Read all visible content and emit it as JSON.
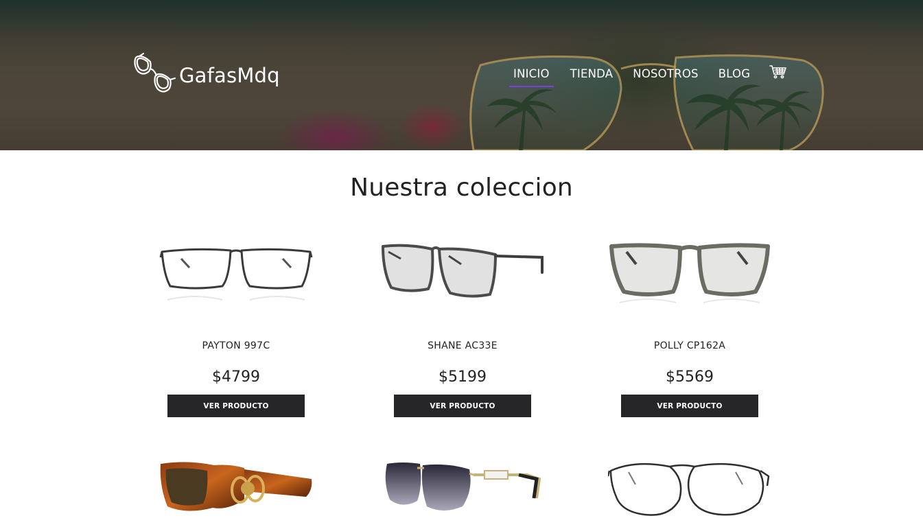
{
  "brand": {
    "name": "GafasMdq",
    "icon": "glasses-logo-icon"
  },
  "nav": {
    "items": [
      {
        "label": "INICIO",
        "active": true
      },
      {
        "label": "TIENDA",
        "active": false
      },
      {
        "label": "NOSOTROS",
        "active": false
      },
      {
        "label": "BLOG",
        "active": false
      }
    ],
    "cart_icon": "cart-icon"
  },
  "colors": {
    "accent": "#7b3fe0",
    "button_bg": "#262628",
    "button_text": "#ffffff",
    "text": "#222222"
  },
  "collection": {
    "title": "Nuestra coleccion",
    "button_label": "VER PRODUCTO",
    "products": [
      {
        "name": "PAYTON 997C",
        "price": "$4799"
      },
      {
        "name": "SHANE AC33E",
        "price": "$5199"
      },
      {
        "name": "POLLY CP162A",
        "price": "$5569"
      }
    ]
  }
}
